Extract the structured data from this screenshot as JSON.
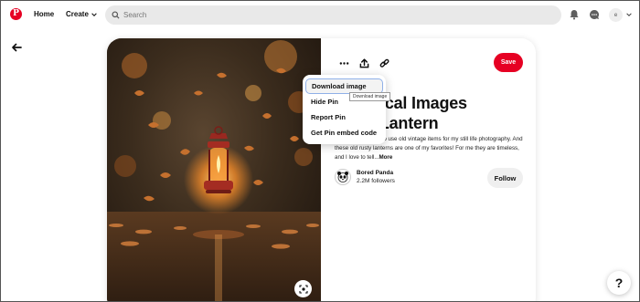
{
  "header": {
    "logo_letter": "P",
    "nav": {
      "home": "Home",
      "create": "Create"
    },
    "search": {
      "placeholder": "Search"
    },
    "icons": [
      "bell-icon",
      "messages-icon",
      "account-chevron-icon"
    ],
    "avatar_initial": "e"
  },
  "pin": {
    "actions": [
      "more-options-icon",
      "share-icon",
      "copy-link-icon"
    ],
    "save_label": "Save",
    "title_line1": "e Magical Images",
    "title_line2": "y Old Lantern",
    "description": "grapher and I love to use old vintage items for my still life photography. And these old rusty lanterns are one of my favorites! For me they are timeless, and I love to tell...",
    "more_label": "More",
    "creator": {
      "name": "Bored Panda",
      "followers": "2.2M followers"
    },
    "follow_label": "Follow"
  },
  "menu": {
    "items": [
      {
        "label": "Download image",
        "active": true
      },
      {
        "label": "Hide Pin",
        "active": false
      },
      {
        "label": "Report Pin",
        "active": false
      },
      {
        "label": "Get Pin embed code",
        "active": false
      }
    ],
    "tooltip": "Download image"
  },
  "help": {
    "label": "?"
  },
  "colors": {
    "brand": "#e60023",
    "search_bg": "#e9e9e9",
    "follow_bg": "#efefef"
  }
}
